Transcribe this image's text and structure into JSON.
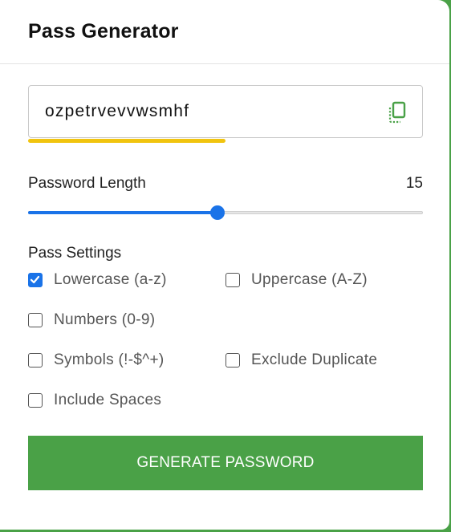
{
  "header": {
    "title": "Pass Generator"
  },
  "password": {
    "value": "ozpetrvevvwsmhf",
    "copy_icon": "copy-icon",
    "strength_color": "#f1c40f"
  },
  "length": {
    "label": "Password Length",
    "value": "15",
    "slider_fraction": 0.48
  },
  "settings": {
    "label": "Pass Settings",
    "options": [
      {
        "label": "Lowercase (a-z)",
        "checked": true
      },
      {
        "label": "Uppercase (A-Z)",
        "checked": false
      },
      {
        "label": "Numbers (0-9)",
        "checked": false
      },
      {
        "label": "Symbols (!-$^+)",
        "checked": false
      },
      {
        "label": "Exclude Duplicate",
        "checked": false
      },
      {
        "label": "Include Spaces",
        "checked": false
      }
    ]
  },
  "actions": {
    "generate_label": "GENERATE PASSWORD"
  },
  "colors": {
    "accent": "#1a73e8",
    "button": "#4aa147",
    "strength": "#f1c40f"
  }
}
